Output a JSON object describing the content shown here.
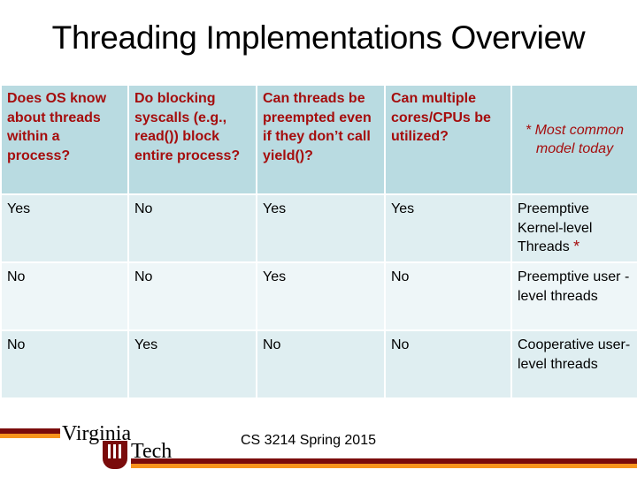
{
  "title": "Threading Implementations Overview",
  "table": {
    "headers": [
      "Does OS know about threads within a process?",
      "Do blocking syscalls (e.g., read()) block entire process?",
      "Can threads be preempted even if they don’t call yield()?",
      "Can multiple cores/CPUs be utilized?",
      "* Most common model today"
    ],
    "rows": [
      [
        "Yes",
        "No",
        "Yes",
        "Yes",
        "Preemptive Kernel-level Threads"
      ],
      [
        "No",
        "No",
        "Yes",
        "No",
        "Preemptive user -level threads"
      ],
      [
        "No",
        "Yes",
        "No",
        "No",
        "Cooperative user-level threads"
      ]
    ],
    "row1_marker": "*"
  },
  "footer": {
    "logo_line1": "Virginia",
    "logo_line2": "Tech",
    "text": "CS 3214 Spring 2015"
  },
  "colors": {
    "header_bg": "#b9dbe1",
    "header_text": "#a50d0d",
    "maroon": "#7a0b0b",
    "orange": "#f7941d"
  }
}
